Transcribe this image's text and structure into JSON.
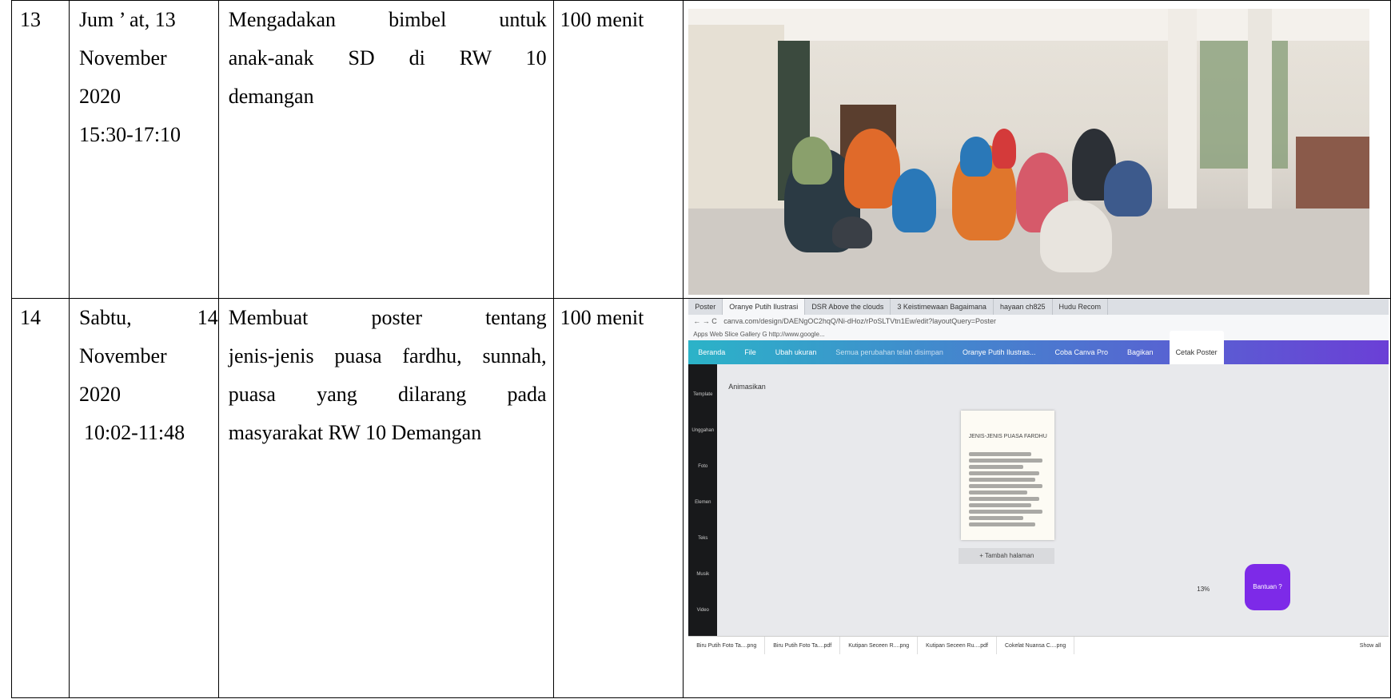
{
  "rows": [
    {
      "no": "13",
      "date_lines": [
        "Jum ’ at, 13",
        "November",
        "2020",
        "15:30-17:10"
      ],
      "activity_lines": [
        "Mengadakan bimbel untuk",
        "anak-anak SD di RW 10",
        "demangan"
      ],
      "duration": "100 menit"
    },
    {
      "no": "14",
      "date_lines": [
        "Sabtu, 14",
        "November",
        "2020",
        "10:02-11:48"
      ],
      "activity_lines": [
        "Membuat poster tentang",
        "jenis-jenis puasa fardhu, sunnah,",
        "puasa yang dilarang pada",
        "masyarakat RW 10 Demangan"
      ],
      "duration": "100 menit"
    }
  ],
  "screenshot": {
    "tabs": [
      "Poster",
      "Oranye Putih Ilustrasi",
      "DSR Above the clouds",
      "3 Keistimewaan Bagaimana",
      "hayaan ch825",
      "Hudu Recom"
    ],
    "url": "canva.com/design/DAENgOC2hqQ/Ni-dHoz/rPoSLTVtn1Ew/edit?layoutQuery=Poster",
    "bookmarks": "Apps   Web Slice Gallery   G  http://www.google...",
    "toolbar": {
      "home": "Beranda",
      "file": "File",
      "resize": "Ubah ukuran",
      "saved": "Semua perubahan telah disimpan",
      "doc_title": "Oranye Putih Ilustras...",
      "try_pro": "Coba Canva Pro",
      "share": "Bagikan",
      "print": "Cetak Poster"
    },
    "sidebar": [
      "Template",
      "Unggahan",
      "Foto",
      "Elemen",
      "Teks",
      "Musik",
      "Video"
    ],
    "animate": "Animasikan",
    "poster_title": "JENIS-JENIS PUASA FARDHU",
    "add_page": "+ Tambah halaman",
    "zoom": "13%",
    "help": "Bantuan ?",
    "downloads": [
      "Biru Putih Foto Ta....png",
      "Biru Putih Foto Ta....pdf",
      "Kutipan Seceen R....png",
      "Kutipan Seceen Ru....pdf",
      "Cokelat Nuansa C....png"
    ],
    "show_all": "Show all"
  },
  "colors": {
    "border": "#000000",
    "canva_gradient_start": "#2bb3c8",
    "canva_gradient_end": "#6b3fd6",
    "help_button": "#7d2ae8"
  }
}
